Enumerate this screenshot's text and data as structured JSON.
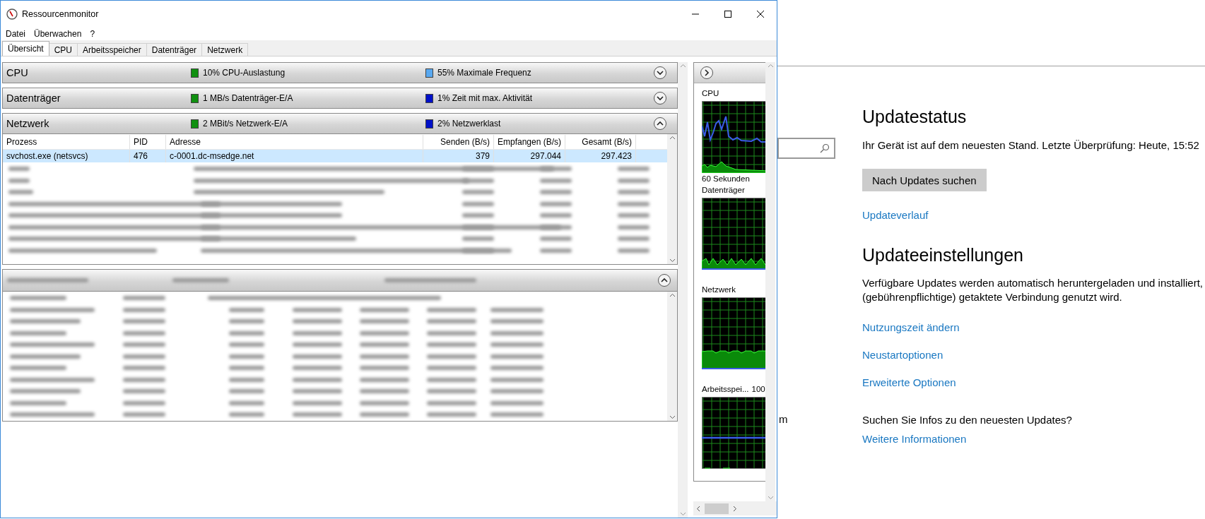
{
  "resource_monitor": {
    "window": {
      "title": "Ressourcenmonitor"
    },
    "menu": [
      "Datei",
      "Überwachen",
      "?"
    ],
    "tabs": [
      {
        "label": "Übersicht",
        "selected": true
      },
      {
        "label": "CPU",
        "selected": false
      },
      {
        "label": "Arbeitsspeicher",
        "selected": false
      },
      {
        "label": "Datenträger",
        "selected": false
      },
      {
        "label": "Netzwerk",
        "selected": false
      }
    ],
    "sections": [
      {
        "title": "CPU",
        "expanded": false,
        "stats": [
          {
            "text": "10% CPU-Auslastung",
            "color": "#109010"
          },
          {
            "text": "55% Maximale Frequenz",
            "color": "#58a8f0"
          }
        ]
      },
      {
        "title": "Datenträger",
        "expanded": false,
        "stats": [
          {
            "text": "1 MB/s Datenträger-E/A",
            "color": "#109010"
          },
          {
            "text": "1% Zeit mit max. Aktivität",
            "color": "#0010c8"
          }
        ]
      },
      {
        "title": "Netzwerk",
        "expanded": true,
        "stats": [
          {
            "text": "2 MBit/s Netzwerk-E/A",
            "color": "#109010"
          },
          {
            "text": "2% Netzwerklast",
            "color": "#0010c8"
          }
        ],
        "table": {
          "columns": [
            "Prozess",
            "PID",
            "Adresse",
            "Senden (B/s)",
            "Empfangen (B/s)",
            "Gesamt (B/s)"
          ],
          "rows": [
            {
              "kind": "data",
              "selected": true,
              "cells": [
                "svchost.exe (netsvcs)",
                "476",
                "c-0001.dc-msedge.net",
                "379",
                "297.044",
                "297.423"
              ]
            },
            {
              "kind": "redacted"
            },
            {
              "kind": "redacted"
            },
            {
              "kind": "redacted"
            },
            {
              "kind": "redacted"
            },
            {
              "kind": "redacted"
            },
            {
              "kind": "redacted"
            },
            {
              "kind": "redacted"
            },
            {
              "kind": "redacted"
            }
          ]
        }
      },
      {
        "kind": "redacted",
        "expanded": true,
        "table": {
          "rows": [
            {
              "kind": "redacted"
            },
            {
              "kind": "redacted"
            },
            {
              "kind": "redacted"
            },
            {
              "kind": "redacted"
            },
            {
              "kind": "redacted"
            },
            {
              "kind": "redacted"
            },
            {
              "kind": "redacted"
            },
            {
              "kind": "redacted"
            },
            {
              "kind": "redacted"
            },
            {
              "kind": "redacted"
            }
          ]
        }
      }
    ],
    "graphs": [
      {
        "kind": "cpu",
        "title": "CPU",
        "caption": "60 Sekunden"
      },
      {
        "kind": "disk",
        "title": "Datenträger"
      },
      {
        "kind": "network",
        "title": "Netzwerk"
      },
      {
        "kind": "memory",
        "title": "Arbeitsspei...",
        "scale": "100"
      }
    ]
  },
  "settings": {
    "hidden_label": "m",
    "status_heading": "Updatestatus",
    "status_text": "Ihr Gerät ist auf dem neuesten Stand. Letzte Überprüfung: Heute, 15:52",
    "check_button": "Nach Updates suchen",
    "history_link": "Updateverlauf",
    "settings_heading": "Updateeinstellungen",
    "settings_text": "Verfügbare Updates werden automatisch heruntergeladen und installiert,\n(gebührenpflichtige) getaktete Verbindung genutzt wird.",
    "links": [
      "Nutzungszeit ändern",
      "Neustartoptionen",
      "Erweiterte Optionen"
    ],
    "info_question": "Suchen Sie Infos zu den neuesten Updates?",
    "info_link": "Weitere Informationen"
  }
}
